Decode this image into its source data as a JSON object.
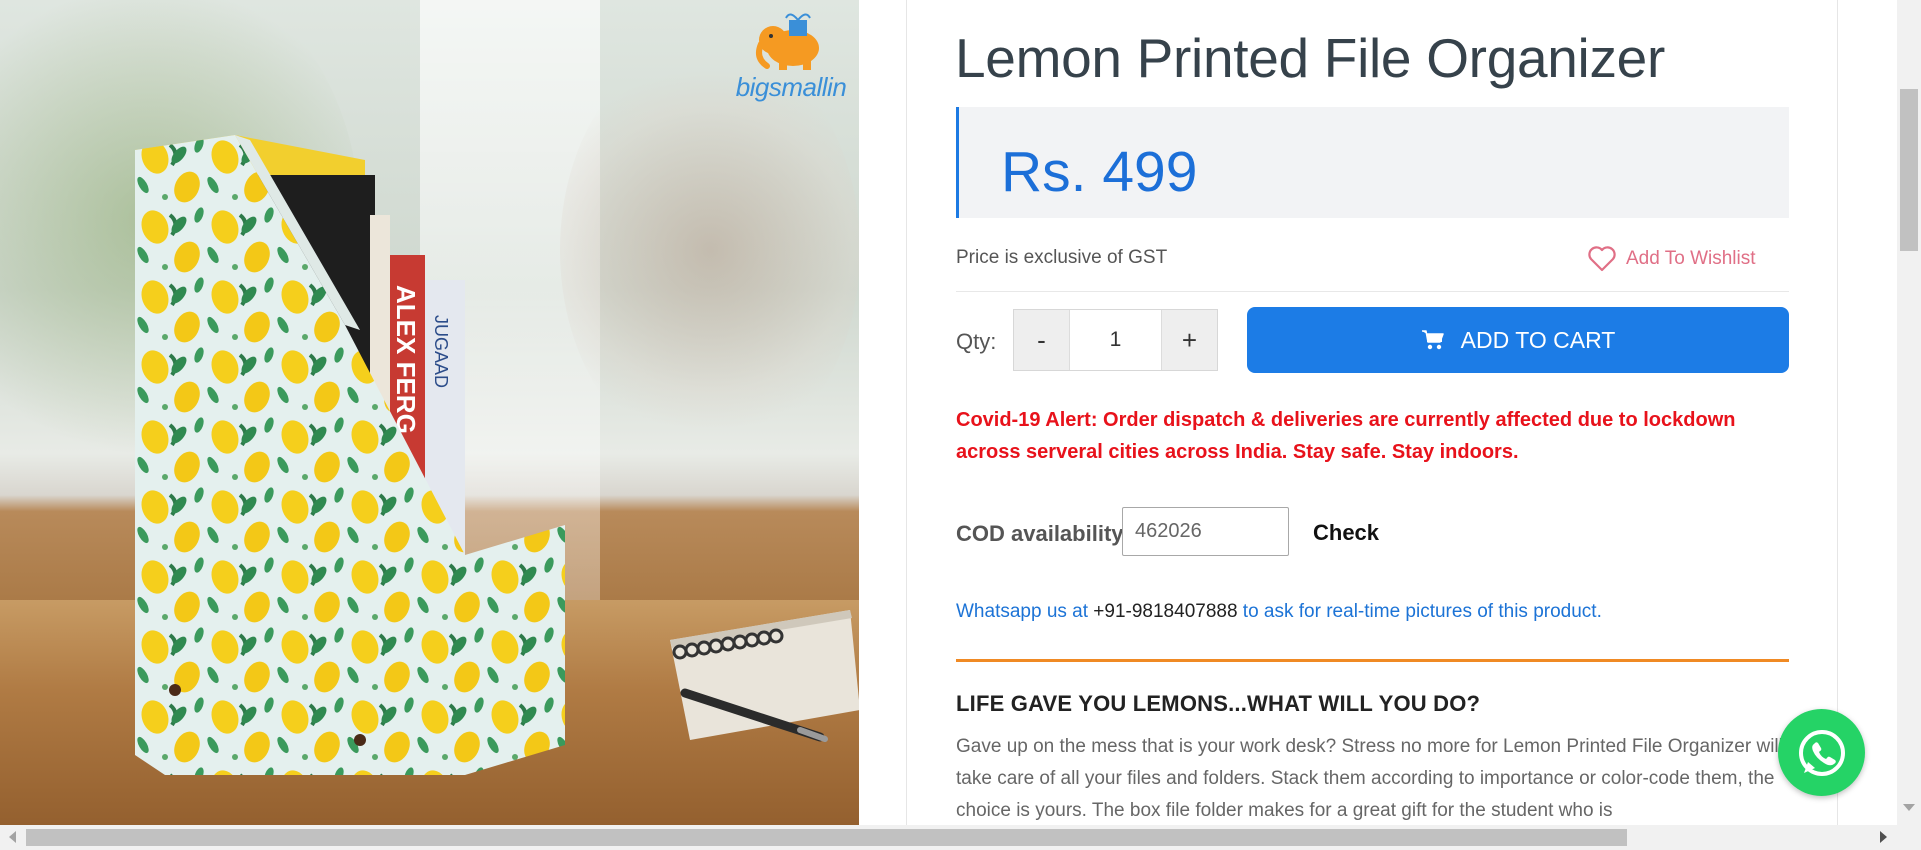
{
  "product": {
    "title": "Lemon Printed File Organizer",
    "price": "Rs. 499",
    "gst_note": "Price is exclusive of GST",
    "image_alt": "Lemon printed file organizer with books",
    "brand_logo_text": "bigsmallin"
  },
  "wishlist": {
    "label": "Add To Wishlist",
    "icon": "heart-icon",
    "color": "#e06f86"
  },
  "quantity": {
    "label": "Qty:",
    "decrement": "-",
    "increment": "+",
    "value": "1"
  },
  "cart": {
    "button_label": "ADD TO CART",
    "icon": "cart-icon",
    "color": "#1c7ce6"
  },
  "alert": {
    "text": "Covid-19 Alert: Order dispatch & deliveries are currently affected due to lockdown across serveral cities across India. Stay safe. Stay indoors.",
    "color": "#e8121b"
  },
  "cod": {
    "label": "COD availability",
    "pincode_value": "462026",
    "check_label": "Check"
  },
  "whatsapp": {
    "prefix": "Whatsapp us at ",
    "phone": "+91-9818407888",
    "suffix": " to ask for real-time pictures of this product.",
    "float_icon": "whatsapp-icon"
  },
  "description": {
    "heading": "LIFE GAVE YOU LEMONS...WHAT WILL YOU DO?",
    "body": "Gave up on the mess that is your work desk? Stress no more for Lemon Printed File Organizer will take care of all your files and folders. Stack them according to importance or color-code them, the choice is yours. The box file folder makes for a great gift for the student who is"
  },
  "colors": {
    "accent": "#1c7ce6",
    "price": "#1c6fd8",
    "divider": "#f08a24"
  }
}
